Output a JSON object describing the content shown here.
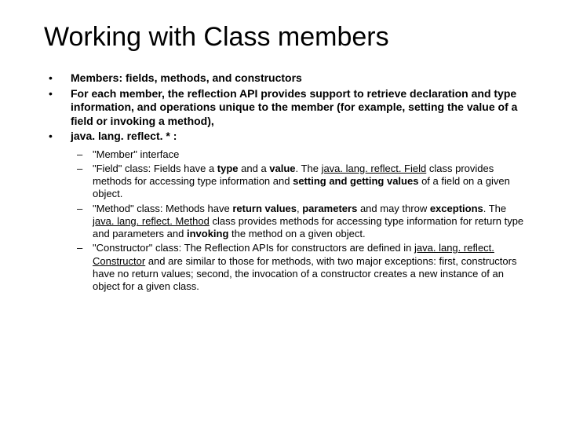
{
  "title": "Working with Class members",
  "bullets": {
    "b1": "Members: fields, methods, and constructors",
    "b2": "For each member, the reflection API  provides support to retrieve declaration and type information, and  operations unique to the member (for example, setting the value of a field or invoking a method),",
    "b3": "java. lang. reflect. * :"
  },
  "sub": {
    "s1": "\"Member\" interface",
    "s2_a": "\"Field\" class: Fields have a ",
    "s2_b": "type",
    "s2_c": " and a ",
    "s2_d": "value",
    "s2_e": ". The ",
    "s2_f": "java. lang. reflect. Field",
    "s2_g": " class provides methods for accessing type information and ",
    "s2_h": "setting and getting values",
    "s2_i": " of a field on a given object.",
    "s3_a": "\"Method\" class: Methods have ",
    "s3_b": "return values",
    "s3_c": ", ",
    "s3_d": "parameters",
    "s3_e": " and may throw ",
    "s3_f": "exceptions",
    "s3_g": ". The ",
    "s3_h": "java. lang. reflect. Method",
    "s3_i": " class provides methods for accessing type information for return type and parameters  and ",
    "s3_j": "invoking",
    "s3_k": " the method on a given object.",
    "s4_a": "\"Constructor\" class: The Reflection APIs for constructors are defined in ",
    "s4_b": "java. lang. reflect. Constructor",
    "s4_c": " and are similar to those for methods, with two major exceptions: first, constructors have no return values; second, the invocation of a constructor creates a new instance of an object for a given class."
  }
}
